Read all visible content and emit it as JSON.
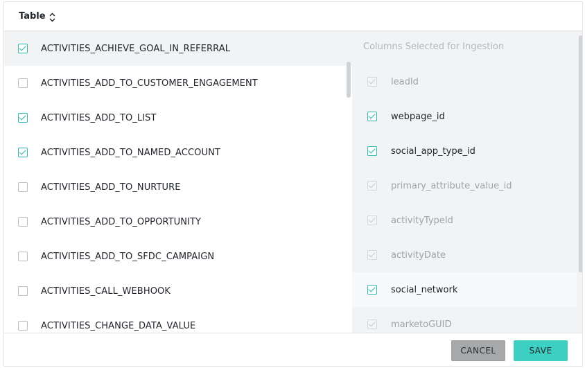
{
  "header": {
    "title": "Table",
    "sort_icon": "sort-updown-icon"
  },
  "tables": [
    {
      "label": "ACTIVITIES_ACHIEVE_GOAL_IN_REFERRAL",
      "checked": true,
      "active": true
    },
    {
      "label": "ACTIVITIES_ADD_TO_CUSTOMER_ENGAGEMENT",
      "checked": false
    },
    {
      "label": "ACTIVITIES_ADD_TO_LIST",
      "checked": true
    },
    {
      "label": "ACTIVITIES_ADD_TO_NAMED_ACCOUNT",
      "checked": true
    },
    {
      "label": "ACTIVITIES_ADD_TO_NURTURE",
      "checked": false
    },
    {
      "label": "ACTIVITIES_ADD_TO_OPPORTUNITY",
      "checked": false
    },
    {
      "label": "ACTIVITIES_ADD_TO_SFDC_CAMPAIGN",
      "checked": false
    },
    {
      "label": "ACTIVITIES_CALL_WEBHOOK",
      "checked": false
    },
    {
      "label": "ACTIVITIES_CHANGE_DATA_VALUE",
      "checked": false
    }
  ],
  "columns_panel": {
    "heading": "Columns Selected for Ingestion",
    "columns": [
      {
        "label": "leadId",
        "checked": true,
        "disabled": true
      },
      {
        "label": "webpage_id",
        "checked": true,
        "disabled": false
      },
      {
        "label": "social_app_type_id",
        "checked": true,
        "disabled": false
      },
      {
        "label": "primary_attribute_value_id",
        "checked": true,
        "disabled": true
      },
      {
        "label": "activityTypeId",
        "checked": true,
        "disabled": true
      },
      {
        "label": "activityDate",
        "checked": true,
        "disabled": true
      },
      {
        "label": "social_network",
        "checked": true,
        "disabled": false,
        "hover": true
      },
      {
        "label": "marketoGUID",
        "checked": true,
        "disabled": true
      }
    ]
  },
  "footer": {
    "cancel_label": "CANCEL",
    "save_label": "SAVE"
  },
  "colors": {
    "accent": "#3ecfc3",
    "check": "#2fb8ac",
    "panel_bg": "#f2f3f5"
  }
}
